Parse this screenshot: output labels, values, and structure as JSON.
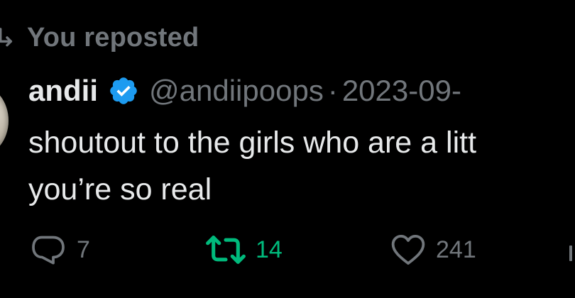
{
  "repost_context": {
    "text": "You reposted",
    "icon": "repost-icon"
  },
  "tweet": {
    "author_name": "andii",
    "verified_icon": "verified-badge-icon",
    "handle": "@andiipoops",
    "separator": "·",
    "date": "2023-09-",
    "body_lines": [
      "shoutout to the girls who are a litt",
      "you’re so real"
    ]
  },
  "actions": {
    "reply_count": "7",
    "repost_count": "14",
    "like_count": "241"
  },
  "colors": {
    "background": "#000000",
    "text_primary": "#e7e9ea",
    "text_secondary": "#71767b",
    "repost_active": "#00ba7c",
    "verified": "#1d9bf0"
  }
}
